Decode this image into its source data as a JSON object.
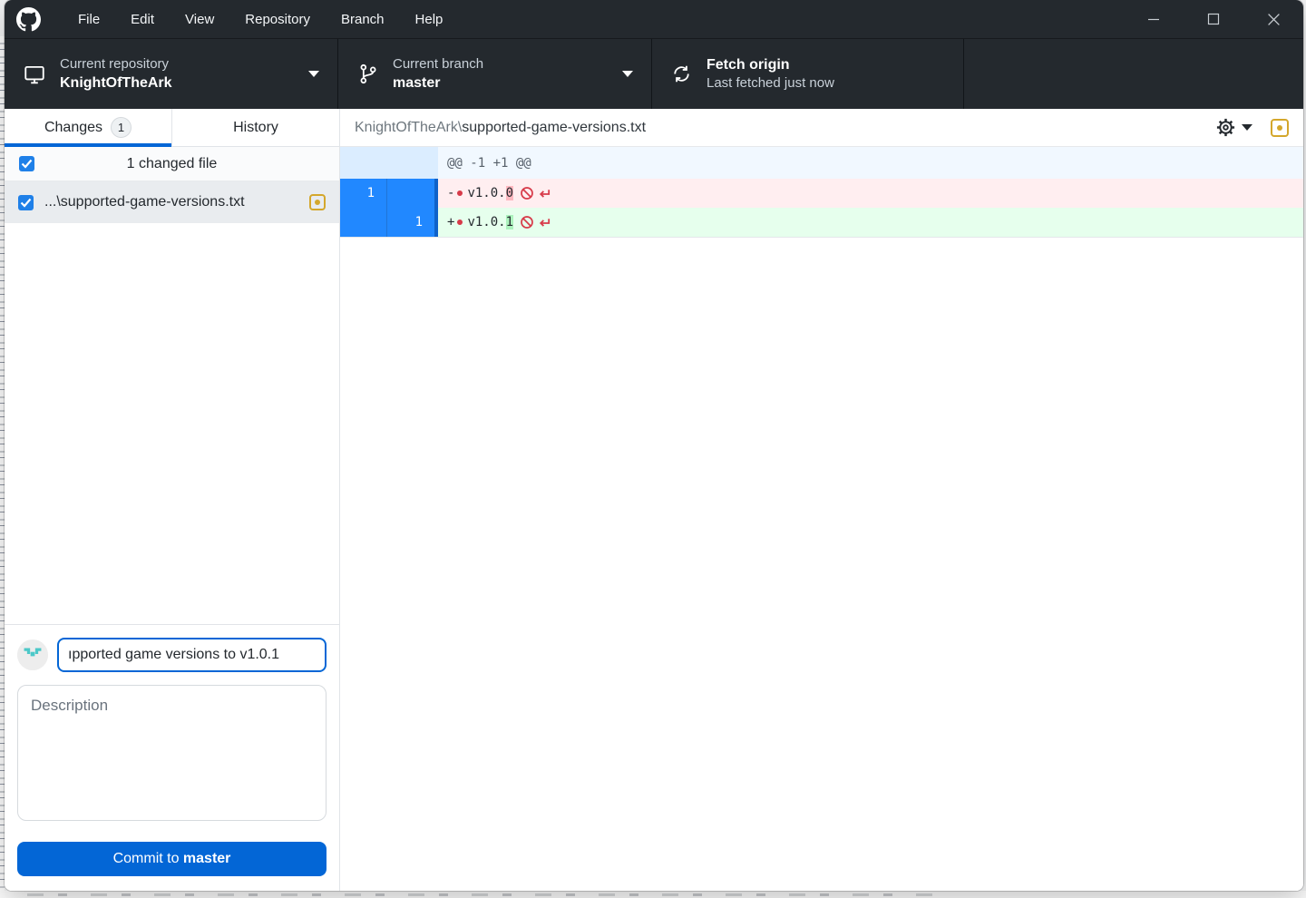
{
  "window": {
    "menus": [
      "File",
      "Edit",
      "View",
      "Repository",
      "Branch",
      "Help"
    ]
  },
  "toolbar": {
    "repository": {
      "label": "Current repository",
      "value": "KnightOfTheArk"
    },
    "branch": {
      "label": "Current branch",
      "value": "master"
    },
    "fetch": {
      "title": "Fetch origin",
      "subtitle": "Last fetched just now"
    }
  },
  "sidebar": {
    "tabs": [
      {
        "label": "Changes",
        "badge": "1",
        "active": true
      },
      {
        "label": "History",
        "active": false
      }
    ],
    "changes_summary": "1 changed file",
    "files": [
      {
        "name": "...\\supported-game-versions.txt",
        "status": "modified",
        "checked": true
      }
    ],
    "commit": {
      "summary_value": "ıpported game versions to v1.0.1",
      "description_placeholder": "Description",
      "button_prefix": "Commit to ",
      "button_branch": "master"
    }
  },
  "diff": {
    "file_path_prefix": "KnightOfTheArk\\",
    "file_name": "supported-game-versions.txt",
    "status": "modified",
    "hunk_header": "@@ -1 +1 @@",
    "rows": [
      {
        "type": "removed",
        "old_line": "1",
        "new_line": "",
        "sign": "-",
        "text": "v1.0.",
        "changed_char": "0"
      },
      {
        "type": "added",
        "old_line": "",
        "new_line": "1",
        "sign": "+",
        "text": "v1.0.",
        "changed_char": "1"
      }
    ]
  },
  "colors": {
    "accent_blue": "#0366d6",
    "titlebar_dark": "#24292e",
    "selected_gutter_blue": "#2188ff",
    "removed_bg": "#ffeef0",
    "removed_highlight": "#fdb8c0",
    "added_bg": "#e6ffed",
    "added_highlight": "#acf2bd",
    "modified_yellow": "#d4a72c",
    "marker_red": "#d73a49",
    "avatar_teal": "#4cc8c8"
  }
}
